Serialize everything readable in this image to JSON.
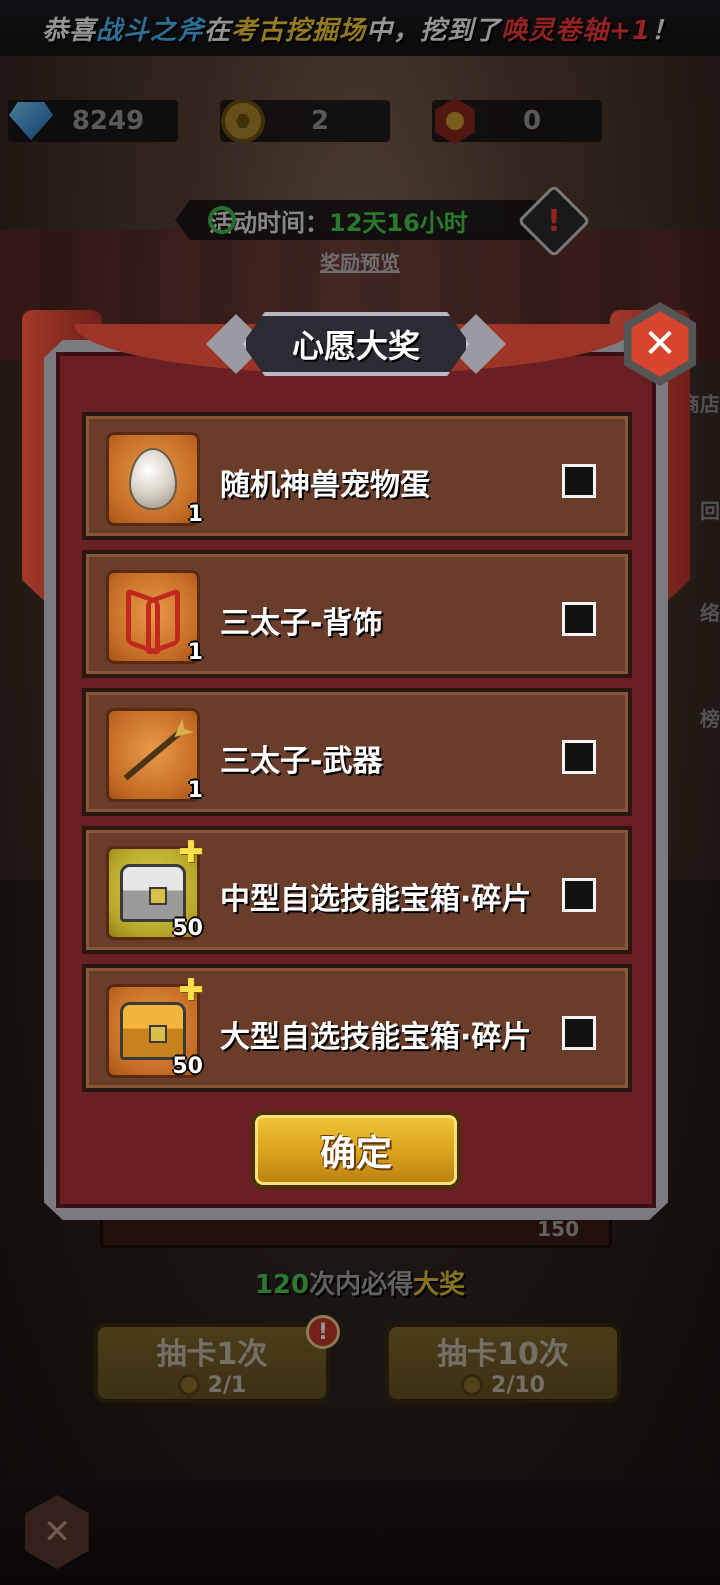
{
  "banner": {
    "p1": "恭喜",
    "player": "战斗之斧",
    "p2": "在",
    "place": "考古挖掘场",
    "p3": "中，挖到了",
    "reward": "唤灵卷轴+1",
    "p4": "！"
  },
  "currencies": [
    {
      "icon": "gem-icon",
      "value": "8249"
    },
    {
      "icon": "coin-icon",
      "value": "2"
    },
    {
      "icon": "medal-icon",
      "value": "0"
    }
  ],
  "activity": {
    "label": "活动时间：",
    "time": "12天16小时",
    "warn": "!",
    "preview_link": "奖励预览"
  },
  "side_tabs": [
    "商店",
    "回",
    "络",
    "榜"
  ],
  "modal": {
    "title": "心愿大奖",
    "close": "✕",
    "items": [
      {
        "name": "随机神兽宠物蛋",
        "count": "1",
        "art": "egg-icon"
      },
      {
        "name": "三太子-背饰",
        "count": "1",
        "art": "wings-icon"
      },
      {
        "name": "三太子-武器",
        "count": "1",
        "art": "spear-icon"
      },
      {
        "name": "中型自选技能宝箱·碎片",
        "count": "50",
        "art": "silver-chest-icon",
        "fragment": true
      },
      {
        "name": "大型自选技能宝箱·碎片",
        "count": "50",
        "art": "gold-chest-icon",
        "fragment": true
      }
    ],
    "confirm_label": "确定"
  },
  "background": {
    "progress_value": "150",
    "guarantee": {
      "count": "120",
      "mid": "次内必得",
      "prize": "大奖"
    },
    "draw_once": {
      "label": "抽卡1次",
      "cost": "2/1"
    },
    "draw_ten": {
      "label": "抽卡10次",
      "cost": "2/10"
    },
    "draw_badge": "!"
  },
  "colors": {
    "banner_blue": "#4fc0ff",
    "banner_yellow": "#ffd23c",
    "banner_red": "#ff3b3b",
    "time_green": "#47d34c",
    "modal_bg": "#6a1f24",
    "item_bg": "#6a3d2a",
    "confirm_gold": "#d9a21c"
  }
}
